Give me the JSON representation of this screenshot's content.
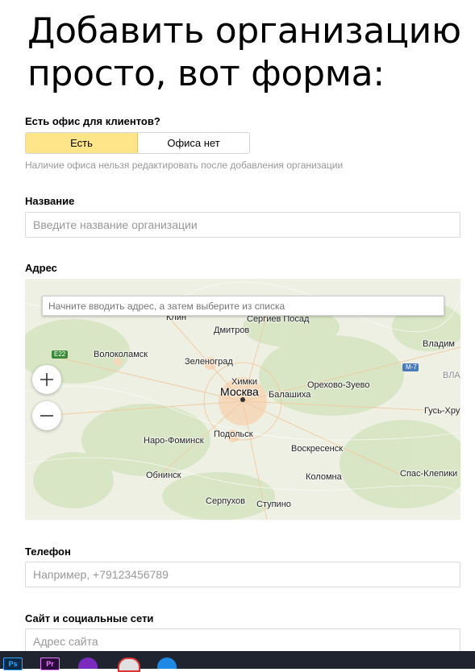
{
  "heading": "Добавить организацию просто, вот форма:",
  "office": {
    "question": "Есть офис для клиентов?",
    "options": [
      "Есть",
      "Офиса нет"
    ],
    "hint": "Наличие офиса нельзя редактировать после добавления организации"
  },
  "name": {
    "label": "Название",
    "placeholder": "Введите название организации"
  },
  "address": {
    "label": "Адрес",
    "placeholder": "Начните вводить адрес, а затем выберите из списка",
    "zoom_in": "+",
    "zoom_out": "−",
    "cities": [
      "Клин",
      "Сергиев Посад",
      "Дмитров",
      "Волоколамск",
      "Зеленоград",
      "Владим",
      "Химки",
      "Москва",
      "Балашиха",
      "Орехово-Зуево",
      "ВЛА",
      "Гусь-Хру",
      "н",
      "Наро-Фоминск",
      "Подольск",
      "Воскресенск",
      "Обнинск",
      "Коломна",
      "Спас-Клепики",
      "Серпухов",
      "Ступино"
    ],
    "road_labels": [
      "E22",
      "М-7"
    ]
  },
  "phone": {
    "label": "Телефон",
    "placeholder": "Например, +79123456789"
  },
  "site": {
    "label": "Сайт и социальные сети",
    "placeholder": "Адрес сайта"
  },
  "taskbar": {
    "icons": [
      "Ps",
      "Pr",
      "podcast-icon",
      "chrome-icon",
      "browser-icon"
    ]
  },
  "colors": {
    "accent": "#ffe589",
    "map_bg": "#eef0e4",
    "taskbar": "#202431"
  }
}
